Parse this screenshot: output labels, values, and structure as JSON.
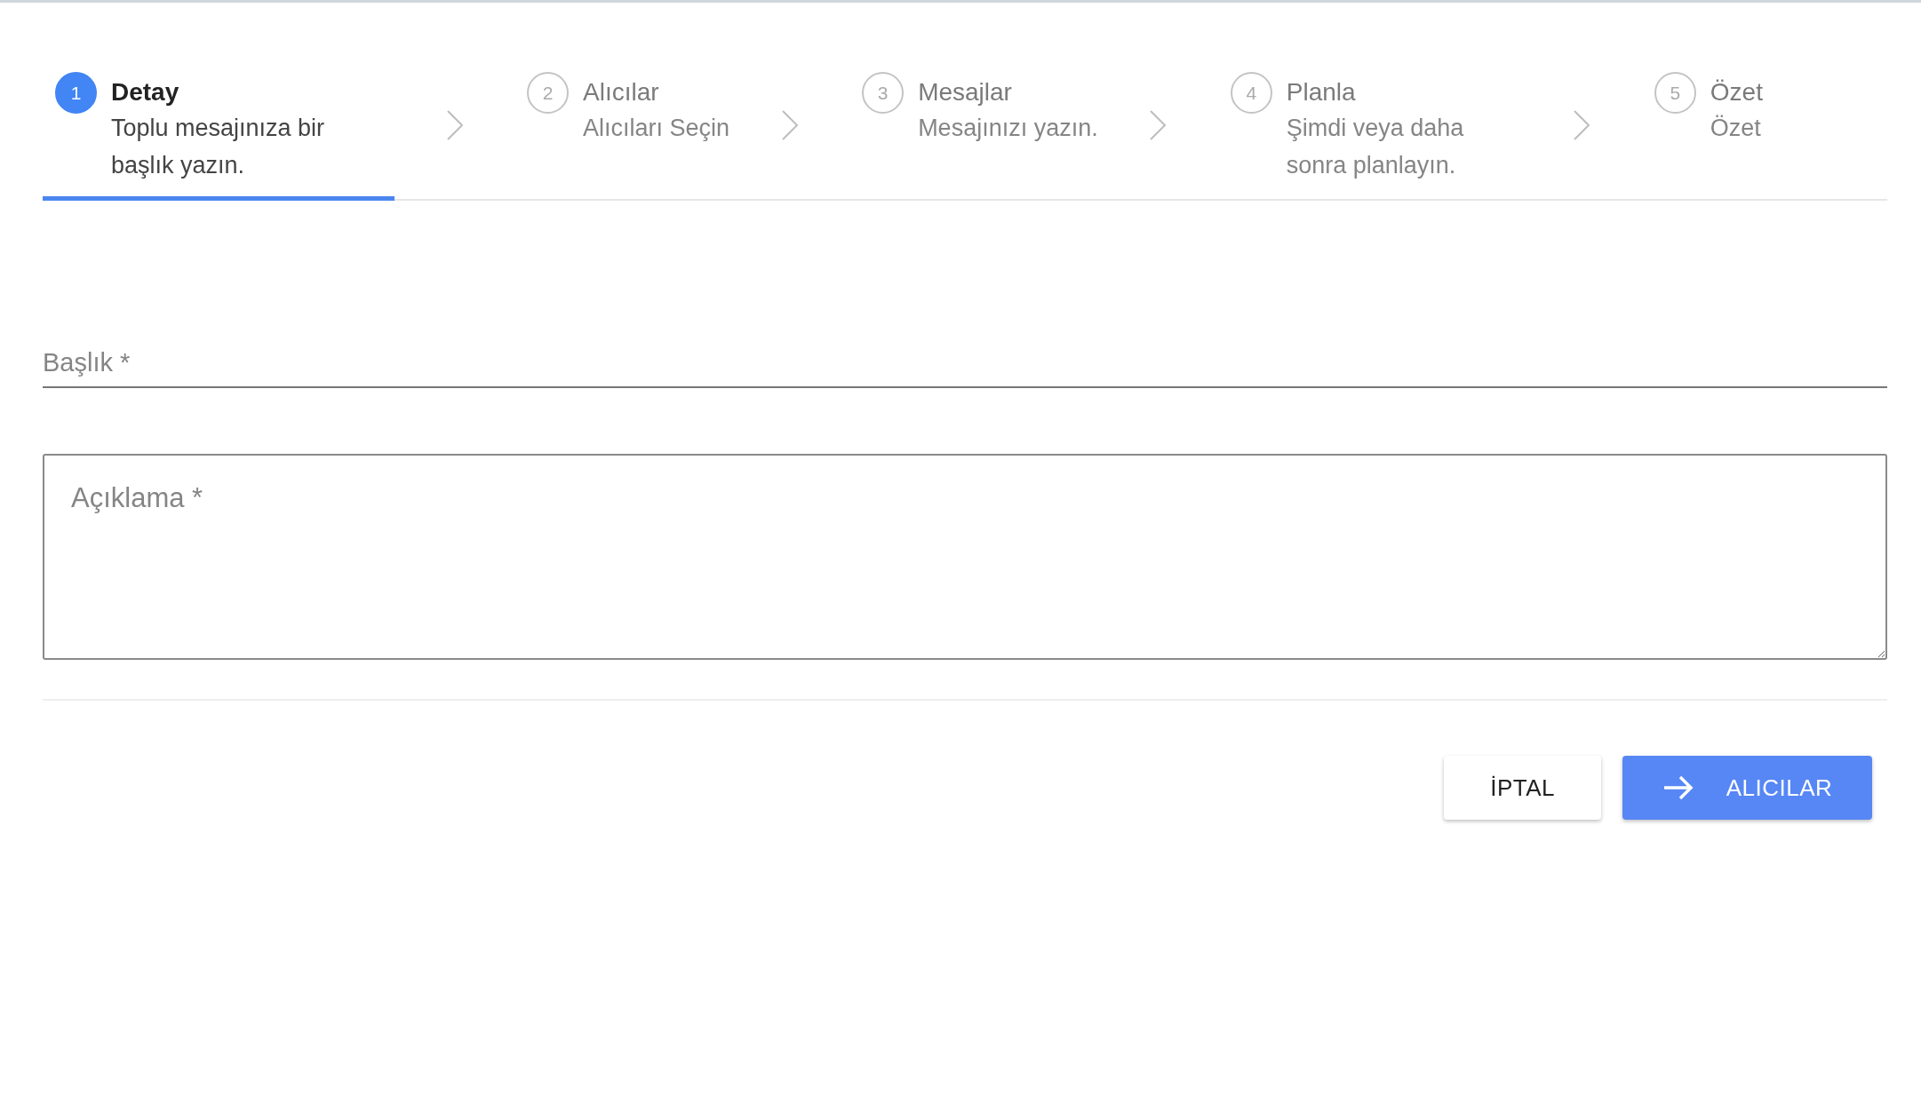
{
  "steps": [
    {
      "number": "1",
      "title": "Detay",
      "subtitle": "Toplu mesajınıza bir başlık yazın.",
      "selected": true
    },
    {
      "number": "2",
      "title": "Alıcılar",
      "subtitle": "Alıcıları Seçin",
      "selected": false
    },
    {
      "number": "3",
      "title": "Mesajlar",
      "subtitle": "Mesajınızı yazın.",
      "selected": false
    },
    {
      "number": "4",
      "title": "Planla",
      "subtitle": "Şimdi veya daha sonra planlayın.",
      "selected": false
    },
    {
      "number": "5",
      "title": "Özet",
      "subtitle": "Özet",
      "selected": false
    }
  ],
  "form": {
    "title_field": {
      "placeholder": "Başlık *"
    },
    "description_field": {
      "placeholder": "Açıklama *"
    }
  },
  "buttons": [
    {
      "label": "İPTAL",
      "kind": "secondary"
    },
    {
      "label": "ALICILAR",
      "kind": "primary"
    }
  ]
}
